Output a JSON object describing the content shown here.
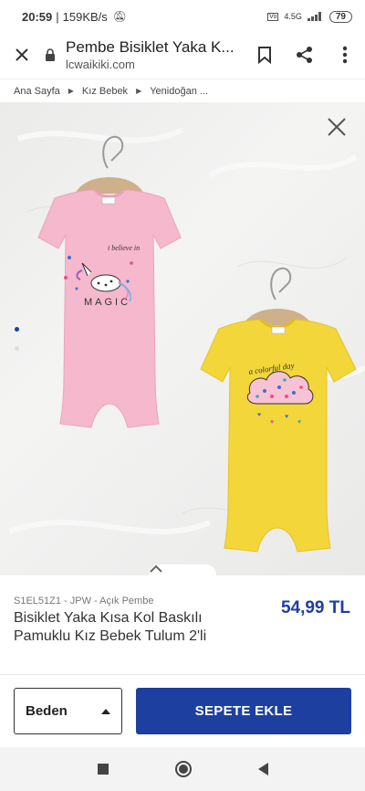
{
  "status_bar": {
    "time": "20:59",
    "speed": "159KB/s",
    "network": "4.5G",
    "battery": "79"
  },
  "browser": {
    "page_title": "Pembe Bisiklet Yaka K...",
    "url": "lcwaikiki.com"
  },
  "breadcrumb": [
    "Ana Sayfa",
    "Kız Bebek",
    "Yenidoğan ..."
  ],
  "gallery": {
    "total_dots": 2,
    "active_index": 0,
    "pink_print_top": "i believe in",
    "pink_print_bottom": "MAGIC",
    "yellow_print": "a colorful day",
    "colors": {
      "pink": "#f5b8cc",
      "yellow": "#f3d63a"
    }
  },
  "product": {
    "sku_line": "S1EL51Z1 - JPW - Açık Pembe",
    "name": "Bisiklet Yaka Kısa Kol Baskılı Pamuklu Kız Bebek Tulum 2'li",
    "price": "54,99 TL"
  },
  "actions": {
    "size_label": "Beden",
    "add_to_cart": "SEPETE EKLE"
  },
  "theme": {
    "accent": "#1d3fa0"
  }
}
